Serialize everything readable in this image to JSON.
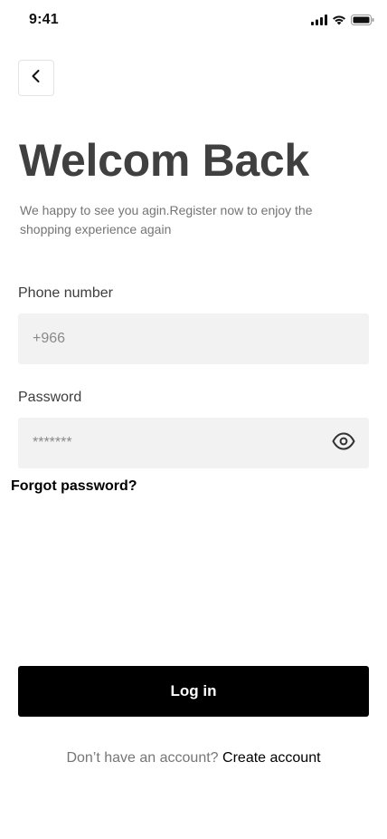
{
  "status_bar": {
    "time": "9:41",
    "icons": [
      "cellular-signal-icon",
      "wifi-icon",
      "battery-icon"
    ]
  },
  "header": {
    "back_icon": "chevron-left-icon"
  },
  "title": "Welcom Back",
  "subtitle": "We happy to see you agin.Register now to enjoy the shopping experience again",
  "form": {
    "phone": {
      "label": "Phone number",
      "placeholder": "+966",
      "value": ""
    },
    "password": {
      "label": "Password",
      "placeholder": "*******",
      "value": "",
      "toggle_icon": "eye-icon"
    },
    "forgot_label": "Forgot password?"
  },
  "login_label": "Log in",
  "signup": {
    "prompt": "Don’t have an account?",
    "link_label": "Create account"
  },
  "colors": {
    "primary_button": "#000000",
    "input_background": "#f2f2f2",
    "title_text": "#404040",
    "muted_text": "#747474"
  }
}
